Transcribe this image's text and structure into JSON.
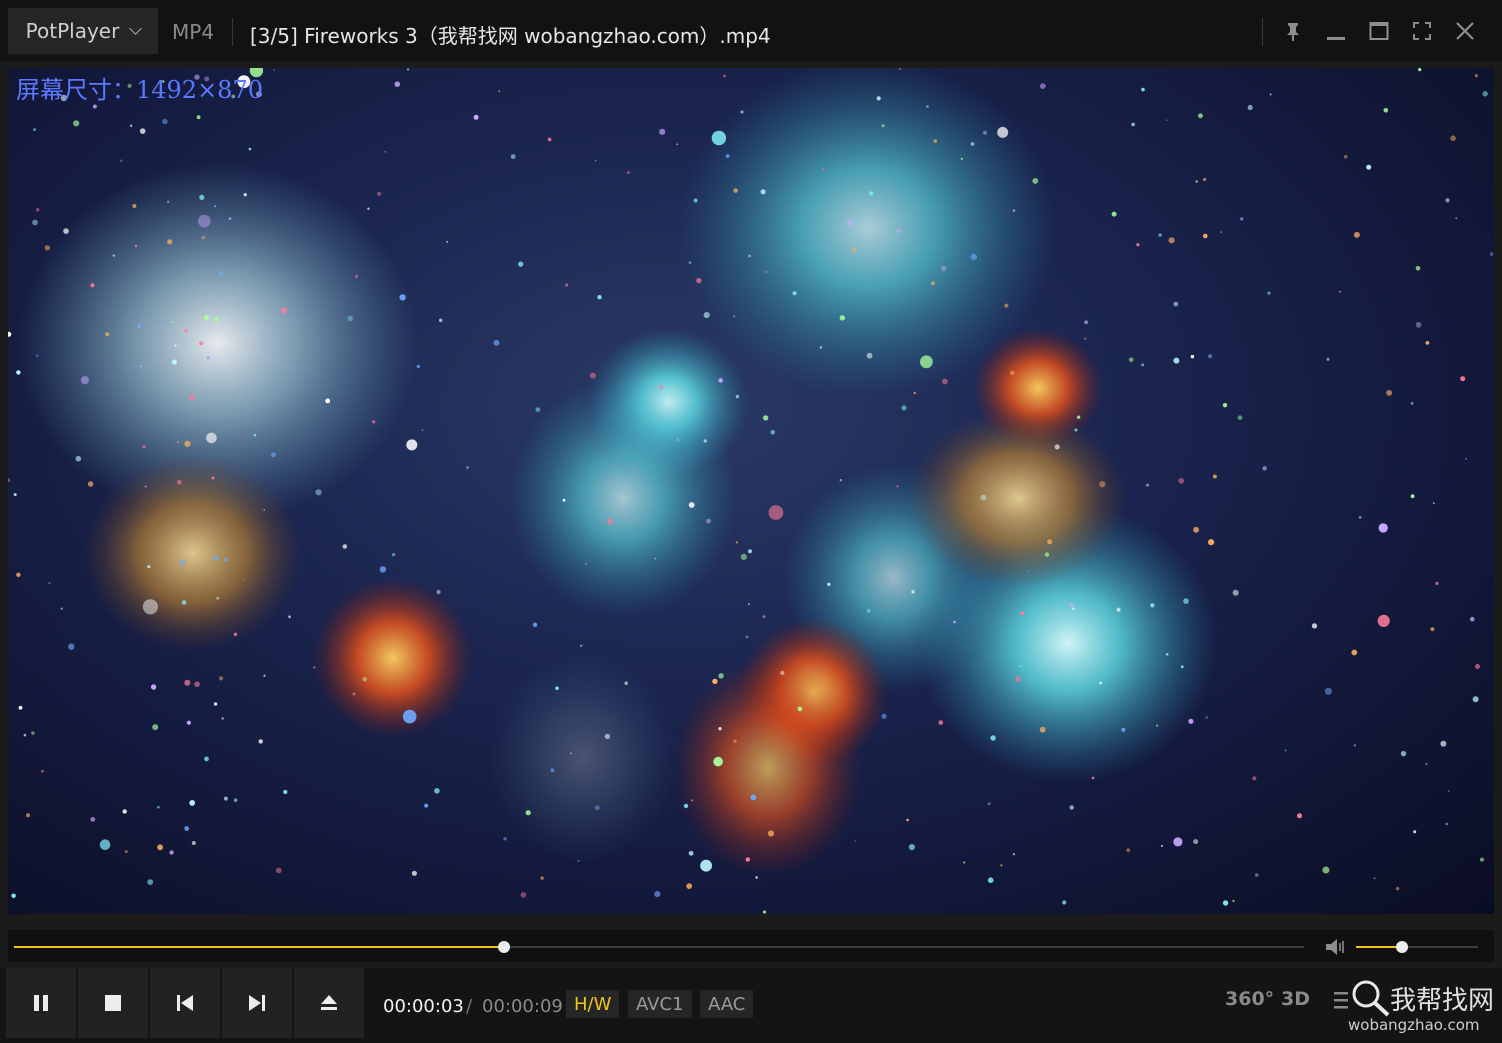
{
  "titlebar": {
    "app_name": "PotPlayer",
    "format": "MP4",
    "title": "[3/5] Fireworks 3（我帮找网 wobangzhao.com）.mp4",
    "icons": [
      "pin-icon",
      "minimize-icon",
      "maximize-icon",
      "fullscreen-icon",
      "close-icon"
    ]
  },
  "osd": {
    "text": "屏幕尺寸：1492×870"
  },
  "playback": {
    "progress_fraction": 0.38,
    "volume_fraction": 0.38
  },
  "controls": {
    "icons": [
      "pause-icon",
      "stop-icon",
      "previous-icon",
      "next-icon",
      "eject-icon"
    ],
    "current_time": "00:00:03",
    "time_separator": "/",
    "total_time": "00:00:09",
    "decoder": "H/W",
    "video_codec": "AVC1",
    "audio_codec": "AAC",
    "mode_360": "360°",
    "mode_3d": "3D"
  },
  "watermark": {
    "cn": "我帮找网",
    "url": "wobangzhao.com"
  },
  "colors": {
    "accent": "#f0c419",
    "osd": "#5b79ff",
    "background": "#1b1b1b"
  }
}
